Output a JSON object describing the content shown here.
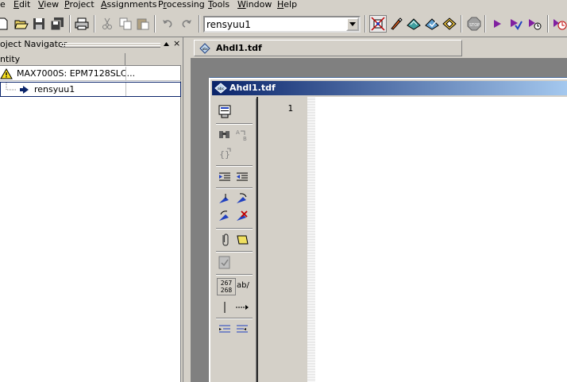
{
  "menu": {
    "items": [
      {
        "pre": "",
        "u": "",
        "post": "e"
      },
      {
        "pre": "",
        "u": "E",
        "post": "dit"
      },
      {
        "pre": "",
        "u": "V",
        "post": "iew"
      },
      {
        "pre": "",
        "u": "P",
        "post": "roject"
      },
      {
        "pre": "",
        "u": "A",
        "post": "ssignments"
      },
      {
        "pre": "P",
        "u": "r",
        "post": "ocessing"
      },
      {
        "pre": "",
        "u": "T",
        "post": "ools"
      },
      {
        "pre": "",
        "u": "W",
        "post": "indow"
      },
      {
        "pre": "",
        "u": "H",
        "post": "elp"
      }
    ]
  },
  "toolbar": {
    "combo_value": "rensyuu1"
  },
  "navigator": {
    "title": "oject Navigator",
    "close_glyph": "×",
    "column_entity": "ntity",
    "rows": [
      {
        "label": "MAX7000S: EPM7128SLC..."
      },
      {
        "label": "rensyuu1"
      }
    ]
  },
  "tab": {
    "label": "Ahdl1.tdf"
  },
  "document": {
    "title": "Ahdl1.tdf",
    "line_number": "1",
    "line_counter_top": "267",
    "line_counter_bottom": "268",
    "ab_label": "ab/"
  },
  "colors": {
    "title_start": "#0a246a",
    "title_end": "#a6caf0",
    "face": "#d4d0c8"
  }
}
